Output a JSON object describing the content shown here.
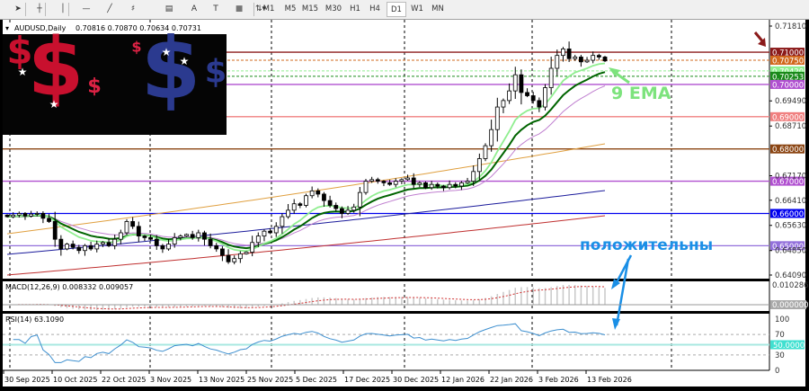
{
  "toolbar": {
    "tools": [
      "cursor-icon",
      "crosshair-icon",
      "vertical-line-icon",
      "horizontal-line-icon",
      "trendline-icon",
      "fibonacci-icon",
      "fibo-channel-icon",
      "text-icon",
      "text-label-icon",
      "rectangle-icon",
      "arrows-dropdown-icon"
    ],
    "text_tool": "A",
    "timeframes": [
      "M1",
      "M5",
      "M15",
      "M30",
      "H1",
      "H4",
      "D1",
      "W1",
      "MN"
    ],
    "active_timeframe": "D1"
  },
  "chart_header": {
    "symbol": "AUDUSD,Daily",
    "ohlc": "0.70816 0.70870 0.70634 0.70731"
  },
  "annotations": {
    "ema_label": "9 EMA",
    "ema_color": "#7de37d",
    "positive_label": "положительны",
    "positive_color": "#1a8fe6",
    "arrow_color": "#8b1a1a"
  },
  "macd": {
    "label": "MACD(12,26,9) 0.008332 0.009057",
    "scale": [
      "0.010286",
      "0.000000"
    ]
  },
  "rsi": {
    "label": "RSI(14) 63.1090",
    "scale": [
      "100",
      "70",
      "30",
      "0"
    ],
    "level_badge": "50.0000",
    "badge_color": "#40e0d0"
  },
  "chart_data": {
    "type": "candlestick",
    "symbol": "AUDUSD",
    "timeframe": "Daily",
    "ylim": [
      0.6409,
      0.7181
    ],
    "y_ticks": [
      "0.71810",
      "0.69490",
      "0.68710",
      "0.67170",
      "0.66410",
      "0.65630",
      "0.64850",
      "0.64090"
    ],
    "x_ticks": [
      "30 Sep 2025",
      "10 Oct 2025",
      "22 Oct 2025",
      "3 Nov 2025",
      "13 Nov 2025",
      "25 Nov 2025",
      "5 Dec 2025",
      "17 Dec 2025",
      "30 Dec 2025",
      "12 Jan 2026",
      "22 Jan 2026",
      "3 Feb 2026",
      "13 Feb 2026"
    ],
    "closes": [
      0.659,
      0.6595,
      0.66,
      0.6592,
      0.6598,
      0.66,
      0.6585,
      0.6575,
      0.652,
      0.649,
      0.6505,
      0.6495,
      0.6485,
      0.65,
      0.649,
      0.6505,
      0.651,
      0.65,
      0.652,
      0.654,
      0.6575,
      0.656,
      0.653,
      0.6525,
      0.652,
      0.65,
      0.649,
      0.6505,
      0.6525,
      0.653,
      0.6535,
      0.6525,
      0.654,
      0.652,
      0.65,
      0.649,
      0.647,
      0.645,
      0.646,
      0.6475,
      0.648,
      0.651,
      0.653,
      0.6545,
      0.654,
      0.656,
      0.659,
      0.661,
      0.663,
      0.6625,
      0.6655,
      0.667,
      0.666,
      0.664,
      0.6625,
      0.6615,
      0.66,
      0.661,
      0.662,
      0.6665,
      0.67,
      0.6705,
      0.67,
      0.6695,
      0.669,
      0.67,
      0.6705,
      0.671,
      0.669,
      0.6695,
      0.668,
      0.669,
      0.6685,
      0.668,
      0.669,
      0.6685,
      0.6695,
      0.67,
      0.673,
      0.677,
      0.681,
      0.686,
      0.693,
      0.695,
      0.698,
      0.703,
      0.6975,
      0.6965,
      0.695,
      0.693,
      0.699,
      0.705,
      0.709,
      0.711,
      0.708,
      0.7085,
      0.707,
      0.7075,
      0.709,
      0.7085,
      0.7073
    ],
    "emas": [
      {
        "period": 9,
        "color": "#90ee90"
      },
      {
        "period": 14,
        "color": "#006400"
      },
      {
        "period": 21,
        "color": "#c080d0"
      }
    ],
    "long_mas": [
      {
        "color": "#e0a040",
        "from": 0.6537,
        "to": 0.6816
      },
      {
        "color": "#1c1c9c",
        "from": 0.6473,
        "to": 0.6671
      },
      {
        "color": "#c03030",
        "from": 0.6409,
        "to": 0.6593
      }
    ],
    "levels": [
      {
        "value": 0.71,
        "label": "0.71000",
        "color": "#8b1a1a",
        "style": "solid"
      },
      {
        "value": 0.7075,
        "label": "0.70750",
        "color": "#d2691e",
        "style": "dashed"
      },
      {
        "value": 0.7042,
        "label": "0.70420",
        "color": "#90ee90",
        "style": "dashed"
      },
      {
        "value": 0.70253,
        "label": "0.70253",
        "color": "#1a8a1a",
        "style": "dashed"
      },
      {
        "value": 0.7,
        "label": "0.70000",
        "color": "#b050d0",
        "style": "solid"
      },
      {
        "value": 0.69,
        "label": "0.69000",
        "color": "#f08080",
        "style": "solid"
      },
      {
        "value": 0.68,
        "label": "0.68000",
        "color": "#8b4513",
        "style": "solid"
      },
      {
        "value": 0.67,
        "label": "0.67000",
        "color": "#b050d0",
        "style": "solid"
      },
      {
        "value": 0.66,
        "label": "0.66000",
        "color": "#0000ee",
        "style": "solid"
      },
      {
        "value": 0.65,
        "label": "0.65000",
        "color": "#9370db",
        "style": "solid"
      }
    ]
  }
}
